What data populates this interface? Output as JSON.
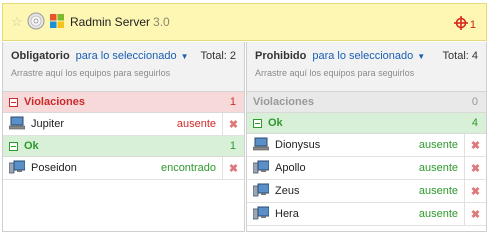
{
  "header": {
    "app_name": "Radmin Server",
    "app_version": "3.0",
    "alert_count": "1"
  },
  "left": {
    "title": "Obligatorio",
    "filter_label": "para lo seleccionado",
    "total": "Total: 2",
    "hint": "Arrastre aquí los equipos para seguirlos",
    "violations": {
      "label": "Violaciones",
      "count": "1"
    },
    "violation_rows": [
      {
        "name": "Jupiter",
        "status": "ausente"
      }
    ],
    "ok": {
      "label": "Ok",
      "count": "1"
    },
    "ok_rows": [
      {
        "name": "Poseidon",
        "status": "encontrado"
      }
    ]
  },
  "right": {
    "title": "Prohibido",
    "filter_label": "para lo seleccionado",
    "total": "Total: 4",
    "hint": "Arrastre aquí los equipos para seguirlos",
    "violations": {
      "label": "Violaciones",
      "count": "0"
    },
    "ok": {
      "label": "Ok",
      "count": "4"
    },
    "ok_rows": [
      {
        "name": "Dionysus",
        "status": "ausente"
      },
      {
        "name": "Apollo",
        "status": "ausente"
      },
      {
        "name": "Zeus",
        "status": "ausente"
      },
      {
        "name": "Hera",
        "status": "ausente"
      }
    ]
  },
  "remove_glyph": "✖"
}
